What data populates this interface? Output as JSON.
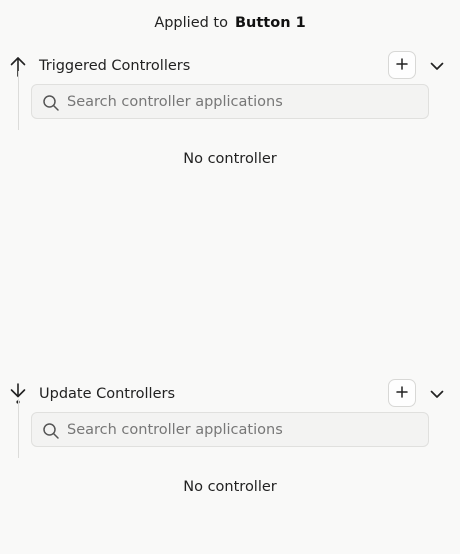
{
  "header": {
    "applied_to_label": "Applied to",
    "target_name": "Button 1"
  },
  "sections": [
    {
      "title": "Triggered Controllers",
      "direction_icon": "arrow-up-icon",
      "search_placeholder": "Search controller applications",
      "search_value": "",
      "empty_text": "No controller"
    },
    {
      "title": "Update Controllers",
      "direction_icon": "arrow-down-icon",
      "search_placeholder": "Search controller applications",
      "search_value": "",
      "empty_text": "No controller"
    }
  ]
}
